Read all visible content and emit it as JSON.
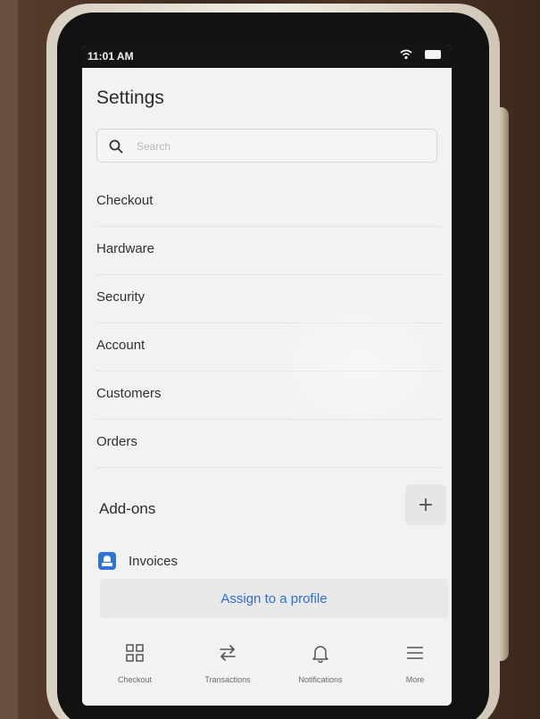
{
  "status_bar": {
    "time": "11:01 AM"
  },
  "header": {
    "title": "Settings"
  },
  "search": {
    "placeholder": "Search"
  },
  "settings_items": [
    {
      "label": "Checkout"
    },
    {
      "label": "Hardware"
    },
    {
      "label": "Security"
    },
    {
      "label": "Account"
    },
    {
      "label": "Customers"
    },
    {
      "label": "Orders"
    }
  ],
  "addons": {
    "title": "Add-ons",
    "add_label": "+",
    "items": [
      {
        "label": "Invoices",
        "icon": "invoices-icon"
      }
    ],
    "assign_label": "Assign to a profile"
  },
  "bottom_nav": [
    {
      "label": "Checkout",
      "icon": "grid-icon"
    },
    {
      "label": "Transactions",
      "icon": "swap-arrows-icon"
    },
    {
      "label": "Notifications",
      "icon": "bell-icon"
    },
    {
      "label": "More",
      "icon": "menu-icon"
    }
  ],
  "colors": {
    "accent": "#2f6fd0",
    "screen_bg": "#f1f2f1",
    "text": "#303030"
  }
}
